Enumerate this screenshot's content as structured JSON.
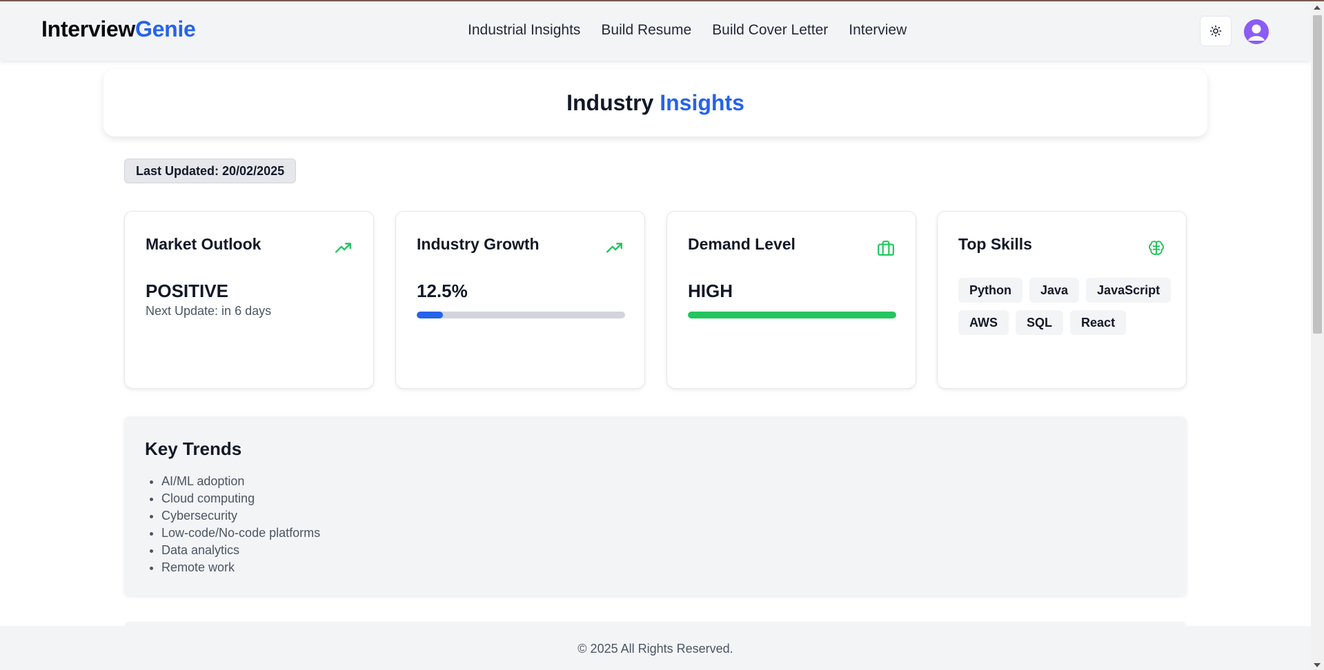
{
  "brand": {
    "part1": "Interview",
    "part2": "Genie"
  },
  "nav": {
    "links": [
      "Industrial Insights",
      "Build Resume",
      "Build Cover Letter",
      "Interview"
    ],
    "theme_icon": "sun-icon",
    "avatar_icon": "user-avatar-icon"
  },
  "page": {
    "title_part1": "Industry",
    "title_part2": "Insights",
    "last_updated": "Last Updated: 20/02/2025"
  },
  "cards": {
    "market": {
      "title": "Market Outlook",
      "value": "POSITIVE",
      "sub": "Next Update: in 6 days",
      "icon": "trending-up-icon"
    },
    "growth": {
      "title": "Industry Growth",
      "value": "12.5%",
      "progress": 0.125,
      "icon": "trending-up-icon"
    },
    "demand": {
      "title": "Demand Level",
      "value": "HIGH",
      "progress": 1.0,
      "icon": "briefcase-icon"
    },
    "skills": {
      "title": "Top Skills",
      "icon": "brain-icon",
      "items": [
        "Python",
        "Java",
        "JavaScript",
        "AWS",
        "SQL",
        "React"
      ]
    }
  },
  "trends": {
    "title": "Key Trends",
    "items": [
      "AI/ML adoption",
      "Cloud computing",
      "Cybersecurity",
      "Low-code/No-code platforms",
      "Data analytics",
      "Remote work"
    ]
  },
  "footer": {
    "text": "© 2025 All Rights Reserved."
  },
  "colors": {
    "accent": "#2563eb",
    "positive": "#22c55e",
    "avatar": "#8b5cf6"
  }
}
